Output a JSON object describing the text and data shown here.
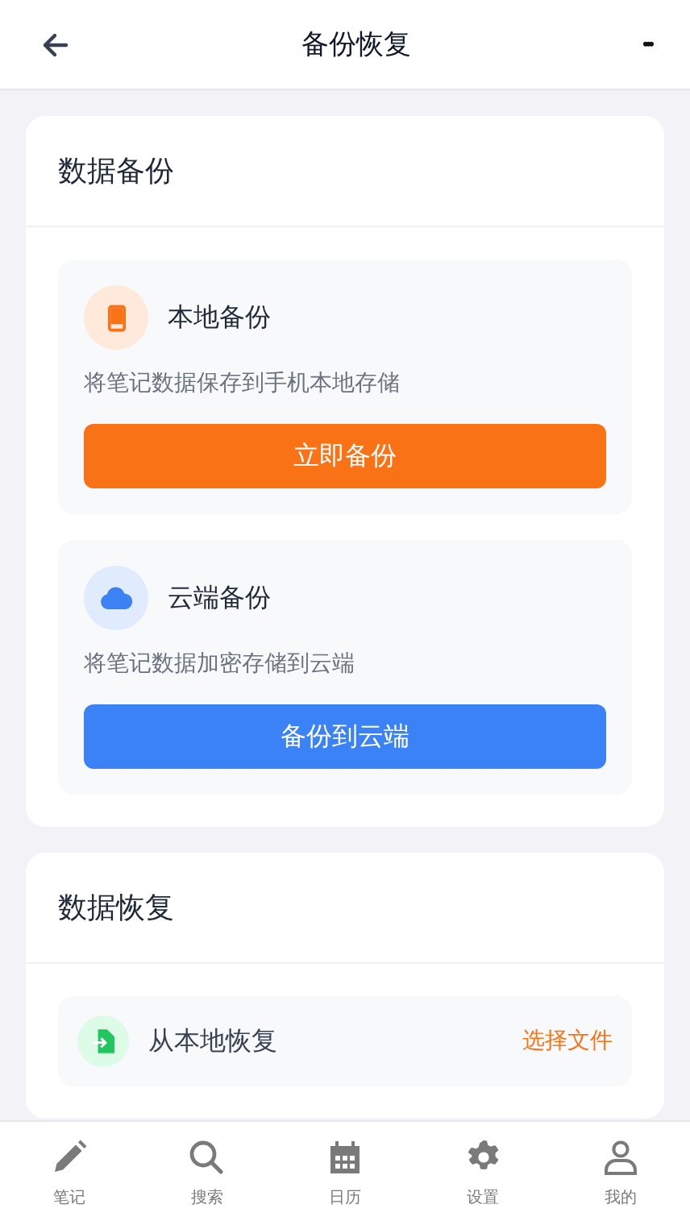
{
  "header": {
    "title": "备份恢复",
    "more": "•••"
  },
  "backup": {
    "title": "数据备份",
    "options": [
      {
        "kind": "phone",
        "title": "本地备份",
        "description": "将笔记数据保存到手机本地存储",
        "button": "立即备份",
        "color": "#f97316"
      },
      {
        "kind": "cloud",
        "title": "云端备份",
        "description": "将笔记数据加密存储到云端",
        "button": "备份到云端",
        "color": "#3b82f6"
      }
    ]
  },
  "restore": {
    "title": "数据恢复",
    "items": [
      {
        "kind": "file",
        "title": "从本地恢复",
        "action": "选择文件"
      }
    ]
  },
  "nav": [
    {
      "kind": "pencil",
      "label": "笔记"
    },
    {
      "kind": "search",
      "label": "搜索"
    },
    {
      "kind": "calendar",
      "label": "日历"
    },
    {
      "kind": "gear",
      "label": "设置"
    },
    {
      "kind": "user",
      "label": "我的"
    }
  ]
}
